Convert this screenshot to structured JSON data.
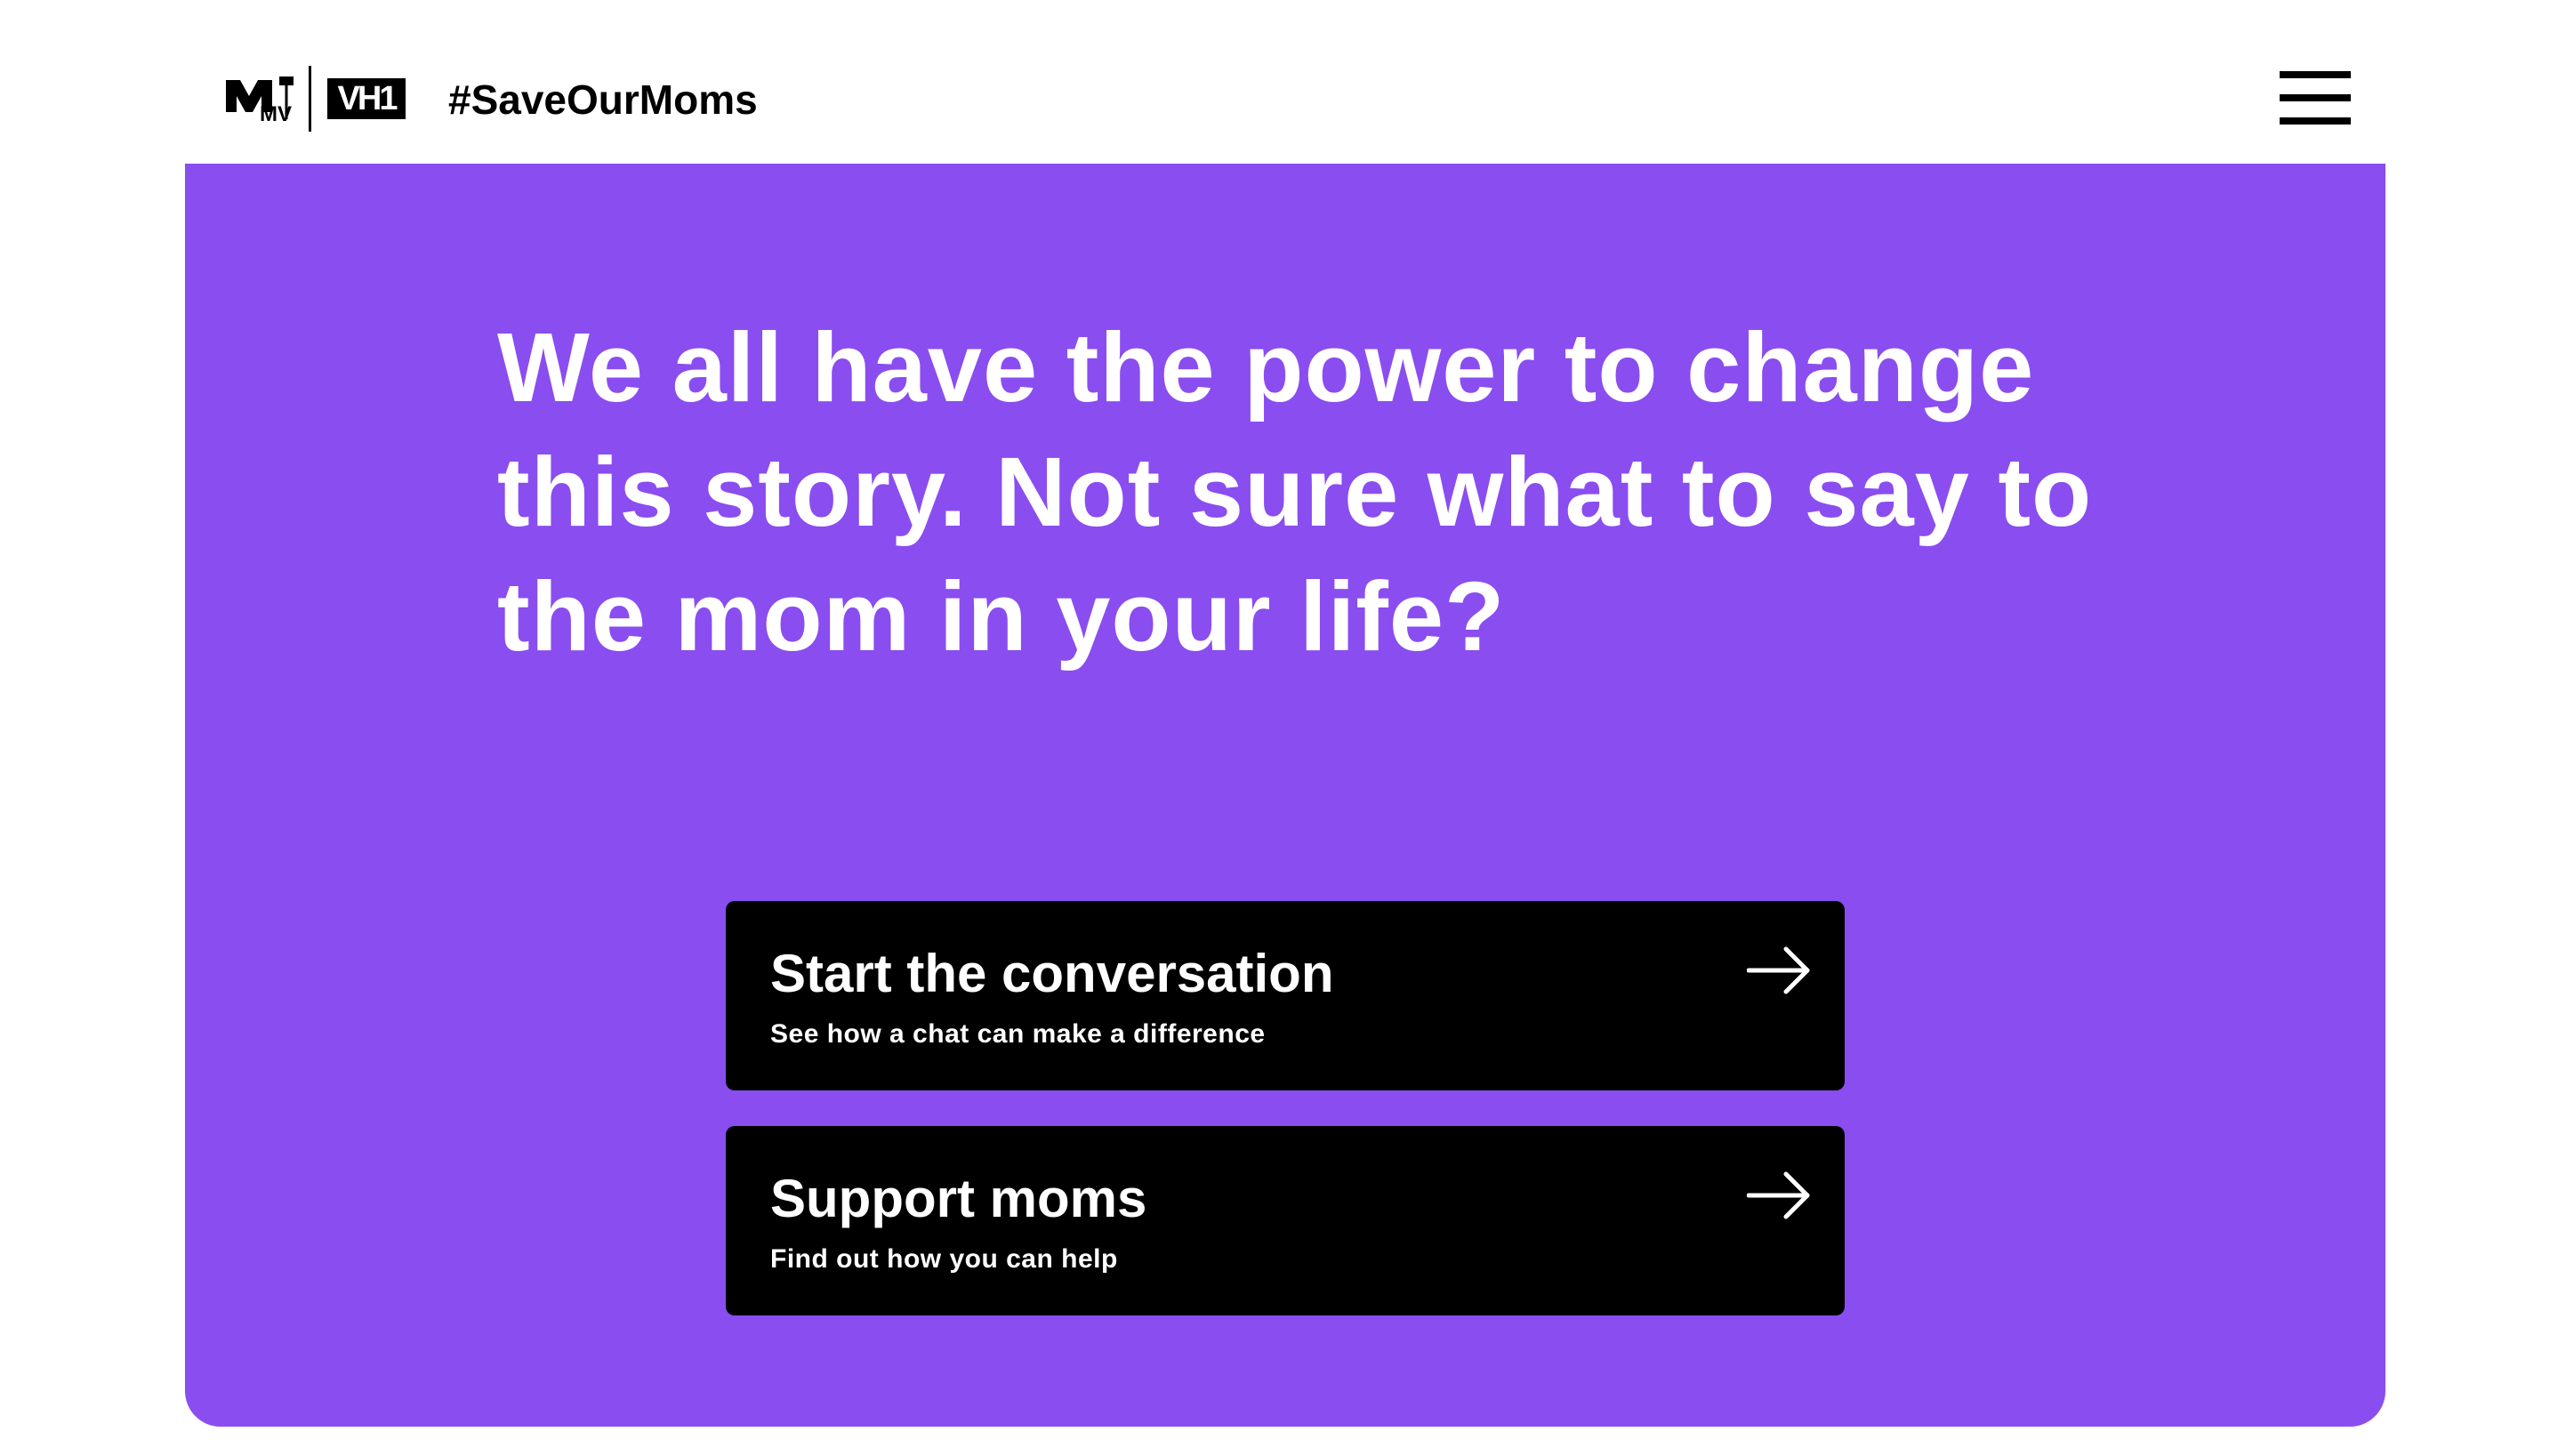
{
  "header": {
    "brand_mtv_alt": "MTV",
    "brand_vh1": "VH1",
    "hashtag": "#SaveOurMoms",
    "menu_icon": "hamburger-menu-icon"
  },
  "hero": {
    "background_color": "#8a4df0",
    "headline": "We all have the power to change this story. Not sure what to say to the mom in your life?"
  },
  "cta": [
    {
      "title": "Start the conversation",
      "subtitle": "See how a chat can make a difference",
      "icon": "arrow-right-icon"
    },
    {
      "title": "Support moms",
      "subtitle": "Find out how you can help",
      "icon": "arrow-right-icon"
    }
  ]
}
